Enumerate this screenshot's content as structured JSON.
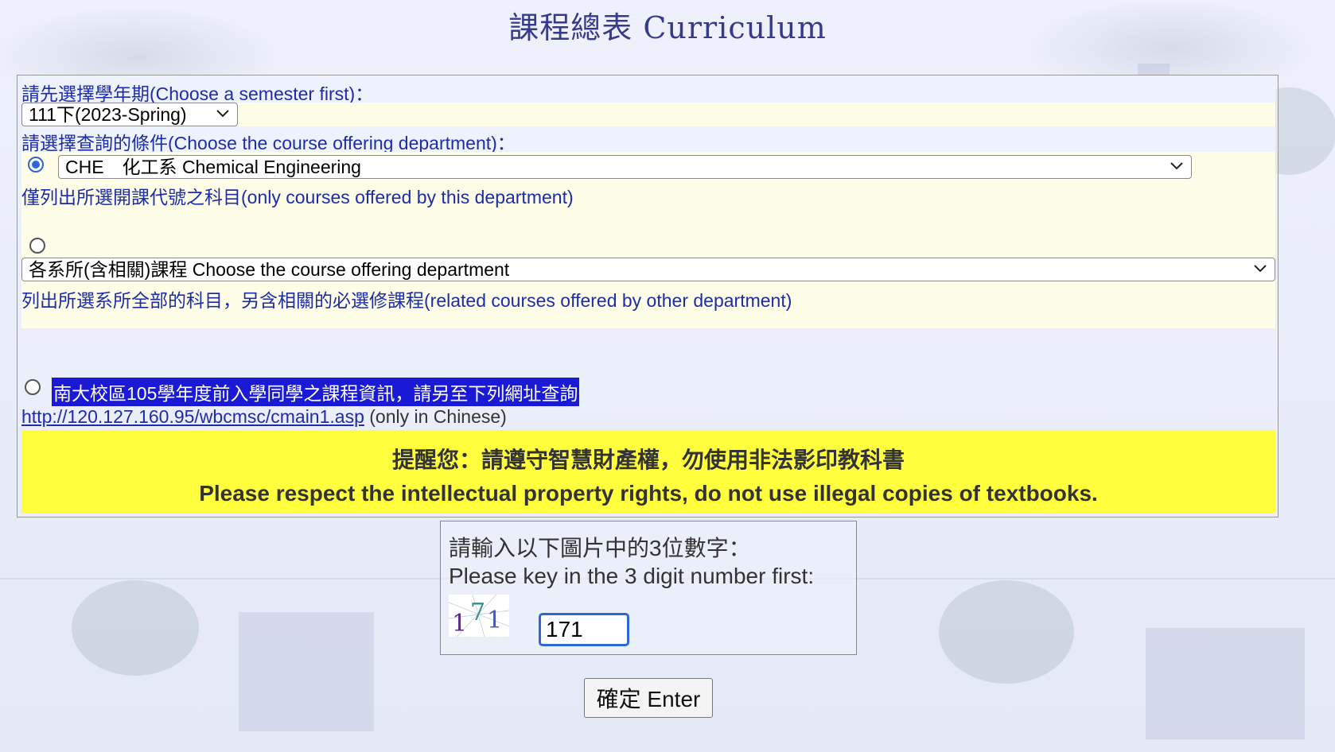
{
  "page_title": "課程總表 Curriculum",
  "semester": {
    "label": "請先選擇學年期(Choose a semester first)：",
    "selected": "111下(2023-Spring)"
  },
  "condition_label": "請選擇查詢的條件(Choose the course offering department)：",
  "option1": {
    "selected_department": "CHE　化工系 Chemical Engineering",
    "description": "僅列出所選開課代號之科目(only courses offered by this department)"
  },
  "option2": {
    "selected_department": "各系所(含相關)課程 Choose the course offering department",
    "description": "列出所選系所全部的科目，另含相關的必選修課程(related courses offered by other department)"
  },
  "option3": {
    "label": "南大校區105學年度前入學同學之課程資訊，請另至下列網址查詢",
    "link": "http://120.127.160.95/wbcmsc/cmain1.asp",
    "link_note": " (only in Chinese)"
  },
  "notice": {
    "zh": "提醒您：請遵守智慧財產權，勿使用非法影印教科書",
    "en": "Please respect the intellectual property rights, do not use illegal copies of textbooks."
  },
  "captcha": {
    "label_zh": "請輸入以下圖片中的3位數字：",
    "label_en": "Please key in the 3 digit number first:",
    "image_digits": "171",
    "input_value": "171"
  },
  "submit_label": "確定 Enter",
  "colors": {
    "title": "#353b8a",
    "label_text": "#1d2ca8",
    "notice_bg": "#ffff3e",
    "highlight_bg": "#1a1ad6",
    "radio_accent": "#2f66d6"
  },
  "icons": {
    "select_arrow": "chevron-down-icon",
    "radio_selected": "radio-selected-icon",
    "radio_unselected": "radio-unselected-icon"
  }
}
